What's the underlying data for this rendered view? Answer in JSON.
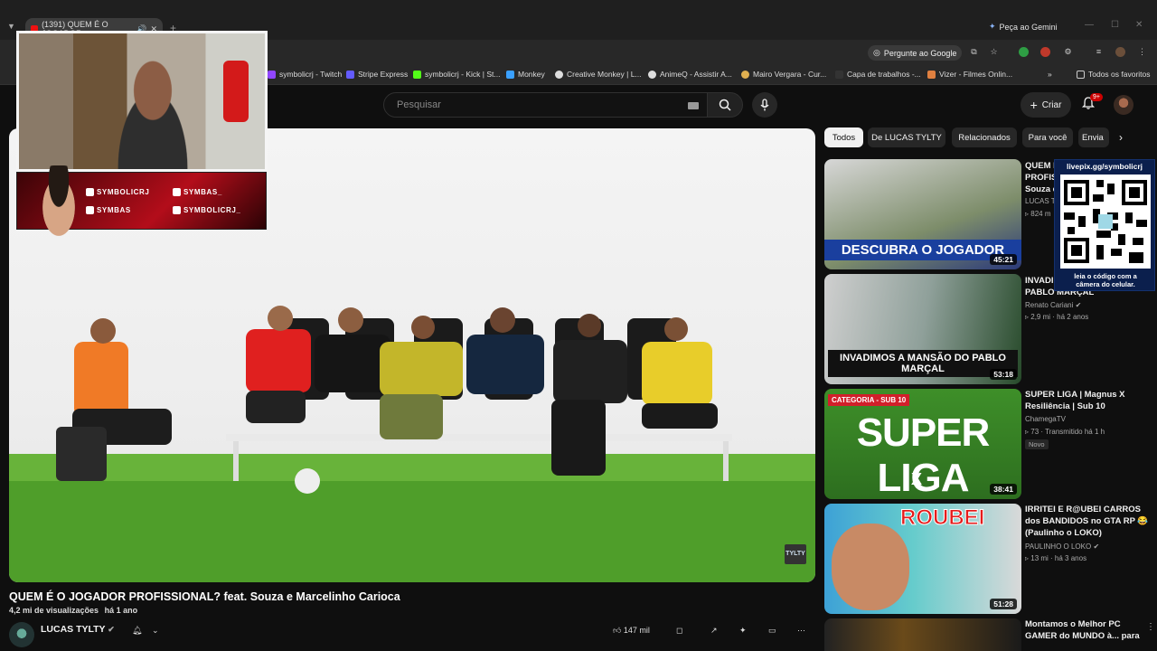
{
  "browser": {
    "tab_title": "(1391) QUEM É O JOGADOR",
    "gemini_label": "Peça ao Gemini",
    "ask_google_label": "Pergunte ao Google"
  },
  "bookmarks": {
    "items": [
      {
        "label": "symbolicrj - Twitch",
        "color": "#9146ff"
      },
      {
        "label": "Stripe Express",
        "color": "#635bff"
      },
      {
        "label": "symbolicrj - Kick | St...",
        "color": "#53fc18"
      },
      {
        "label": "Monkey",
        "color": "#3aa0ff"
      },
      {
        "label": "Creative Monkey | L...",
        "color": "#dddddd"
      },
      {
        "label": "AnimeQ - Assistir A...",
        "color": "#dddddd"
      },
      {
        "label": "Mairo Vergara - Cur...",
        "color": "#e0b050"
      },
      {
        "label": "Capa de trabalhos -...",
        "color": "#333333"
      },
      {
        "label": "Vizer - Filmes Onlin...",
        "color": "#e08040"
      }
    ],
    "all_label": "Todos os favoritos"
  },
  "youtube_header": {
    "search_placeholder": "Pesquisar",
    "create_label": "Criar",
    "notif_badge": "9+"
  },
  "streamer": {
    "socials": [
      "SYMBOLICRJ",
      "SYMBAS_",
      "SYMBAS",
      "SYMBOLICRJ_"
    ]
  },
  "video": {
    "watermark": "TYLTY",
    "title": "QUEM É O JOGADOR PROFISSIONAL? feat. Souza e Marcelinho Carioca",
    "views": "4,2 mi de visualizações",
    "age": "há 1 ano",
    "channel": "LUCAS TYLTY",
    "likes": "147 mil"
  },
  "chips": [
    "Todos",
    "De LUCAS TYLTY",
    "Relacionados",
    "Para você",
    "Envia"
  ],
  "sidebar": [
    {
      "thumb_text": "DESCUBRA O JOGADOR",
      "duration": "45:21",
      "title_a": "QUEM É",
      "title_b": "PROFIS",
      "title_c": "Souza e",
      "channel": "LUCAS T",
      "views": "824 m"
    },
    {
      "thumb_text": "INVADIMOS A MANSÃO DO PABLO MARÇAL",
      "duration": "53:18",
      "title_a": "INVADI",
      "title_b": "PABLO MARÇAL",
      "channel": "Renato Cariani",
      "views": "2,9 mi",
      "age": "há 2 anos"
    },
    {
      "thumb_text": "SUPER LIGA",
      "thumb_tag": "CATEGORIA - SUB 10",
      "duration": "38:41",
      "title_a": "SUPER LIGA | Magnus X",
      "title_b": "Resiliência | Sub 10",
      "channel": "ChamegaTV",
      "views": "73",
      "age": "Transmitido há 1 h",
      "badge": "Novo"
    },
    {
      "thumb_text": "ROUBEI",
      "duration": "51:28",
      "title_a": "IRRITEI E R@UBEI CARROS",
      "title_b": "dos BANDIDOS no GTA RP 😂",
      "title_c": "(Paulinho o LOKO)",
      "channel": "PAULINHO O LOKO",
      "views": "13 mi",
      "age": "há 3 anos"
    },
    {
      "title_a": "Montamos o Melhor PC",
      "title_b": "GAMER do MUNDO à... para"
    }
  ],
  "qr_overlay": {
    "url": "livepix.gg/symbolicrj",
    "caption_a": "leia o código com a",
    "caption_b": "câmera do celular."
  }
}
